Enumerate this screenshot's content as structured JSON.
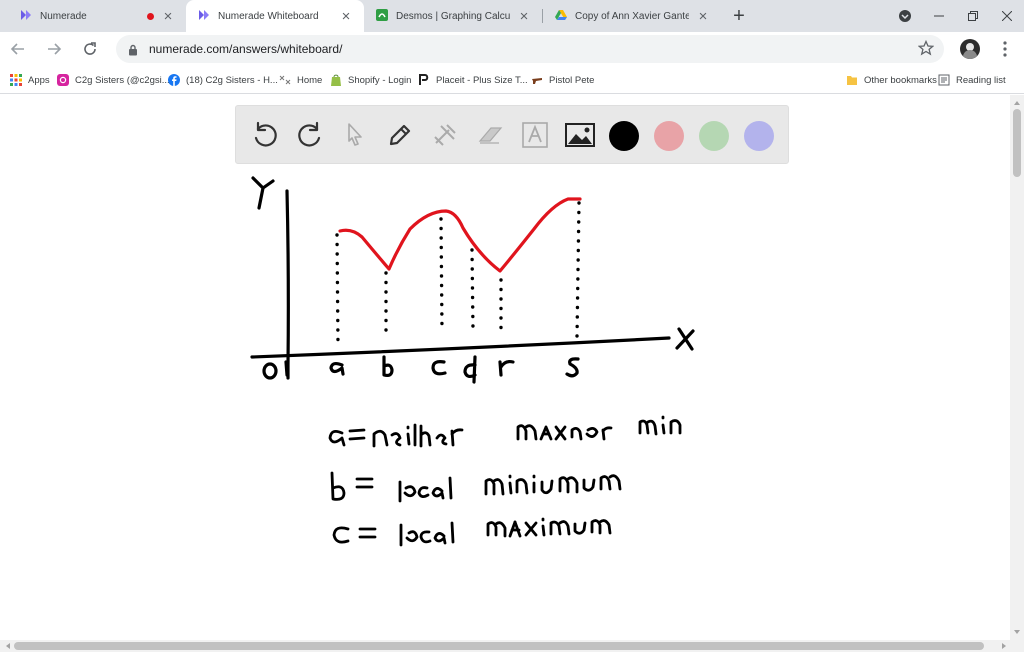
{
  "tabs": [
    {
      "title": "Numerade",
      "icon": "numerade-logo-icon"
    },
    {
      "title": "Numerade Whiteboard",
      "icon": "numerade-logo-icon"
    },
    {
      "title": "Desmos | Graphing Calculator",
      "icon": "desmos-logo-icon"
    },
    {
      "title": "Copy of Ann Xavier Gantert - A",
      "icon": "google-drive-icon"
    }
  ],
  "active_tab_index": 1,
  "toolbar": {
    "url": "numerade.com/answers/whiteboard/"
  },
  "bookmarks": [
    {
      "label": "Apps",
      "icon": "apps-grid-icon"
    },
    {
      "label": "C2g Sisters (@c2gsi...",
      "icon": "instagram-icon"
    },
    {
      "label": "(18) C2g Sisters - H...",
      "icon": "facebook-icon"
    },
    {
      "label": "Home",
      "icon": "home-bookmark-icon"
    },
    {
      "label": "Shopify - Login",
      "icon": "shopify-icon"
    },
    {
      "label": "Placeit - Plus Size T...",
      "icon": "placeit-icon"
    },
    {
      "label": "Pistol Pete",
      "icon": "pistol-pete-icon"
    },
    {
      "label": "Other bookmarks",
      "icon": "folder-icon"
    },
    {
      "label": "Reading list",
      "icon": "reading-list-icon"
    }
  ],
  "whiteboard": {
    "tools": [
      "undo-icon",
      "redo-icon",
      "select-pointer-icon",
      "pen-icon",
      "tools-icon",
      "eraser-icon",
      "text-icon",
      "image-icon"
    ],
    "colors": [
      "#000000",
      "#e8a3a7",
      "#b5d7b3",
      "#b3b3ec"
    ],
    "graph_labels": {
      "y_axis": "Y",
      "x_axis": "X",
      "origin": "O",
      "points": [
        "a",
        "b",
        "c",
        "d",
        "r",
        "s"
      ]
    },
    "notes": [
      "a= neither max nor min",
      "b= local minimum",
      "c= local maximum"
    ],
    "curve_color": "#e0141d",
    "ink_color": "#000000"
  }
}
